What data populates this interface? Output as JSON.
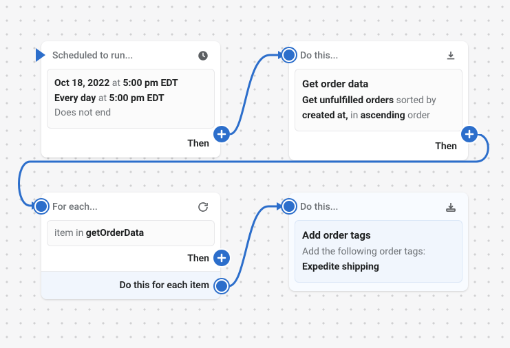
{
  "nodes": {
    "scheduled": {
      "title": "Scheduled to run...",
      "date": "Oct 18, 2022",
      "at_word": "at",
      "time": "5:00 pm EDT",
      "every_day": "Every day",
      "at_word2": "at",
      "time2": "5:00 pm EDT",
      "does_not_end": "Does not end",
      "then": "Then"
    },
    "get_orders": {
      "title": "Do this...",
      "heading": "Get order data",
      "line_prefix": "Get",
      "unfulfilled": "unfulfilled orders",
      "sorted_by": "sorted by",
      "created_at": "created at,",
      "in_word": "in",
      "ascending": "ascending",
      "order_word": "order",
      "then": "Then"
    },
    "foreach": {
      "title": "For each...",
      "item_in": "item in",
      "var": "getOrderData",
      "then": "Then",
      "footer": "Do this for each item"
    },
    "add_tags": {
      "title": "Do this...",
      "heading": "Add order tags",
      "subline": "Add the following order tags:",
      "tag": "Expedite shipping"
    }
  }
}
